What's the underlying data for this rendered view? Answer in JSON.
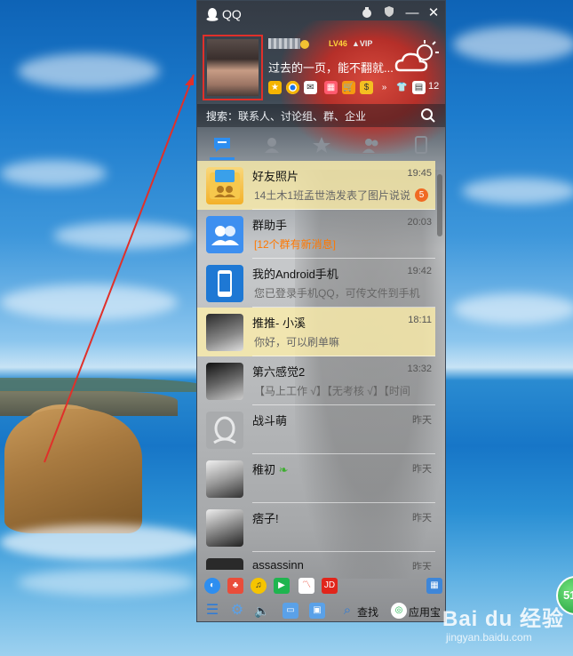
{
  "window": {
    "title": "QQ"
  },
  "profile": {
    "level_badge": "LV46",
    "vip_badge": "VIP",
    "signature": "过去的一页，能不翻就...",
    "app_count": "12"
  },
  "search": {
    "placeholder": "搜索：联系人、讨论组、群、企业"
  },
  "conversations": [
    {
      "title": "好友照片",
      "time": "19:45",
      "message": "14土木1班孟世浩发表了图片说说",
      "unread": "5",
      "highlight": true,
      "icon": "photo-folder-icon"
    },
    {
      "title": "群助手",
      "time": "20:03",
      "message": "[12个群有新消息]",
      "unread": "",
      "highlight": false,
      "icon": "group-helper-icon"
    },
    {
      "title": "我的Android手机",
      "time": "19:42",
      "message": "您已登录手机QQ，可传文件到手机",
      "unread": "",
      "highlight": false,
      "icon": "phone-icon"
    },
    {
      "title": "推推- 小溪",
      "time": "18:11",
      "message": "你好，可以刷单嘛",
      "unread": "",
      "highlight": true,
      "icon": "user-avatar"
    },
    {
      "title": "第六感觉2",
      "time": "13:32",
      "message": "【马上工作 √】【无考核 √】【时间",
      "unread": "",
      "highlight": false,
      "icon": "user-avatar"
    },
    {
      "title": "战斗萌",
      "time": "昨天",
      "message": "",
      "unread": "",
      "highlight": false,
      "icon": "default-avatar"
    },
    {
      "title": "稚初",
      "time": "昨天",
      "message": "",
      "unread": "",
      "highlight": false,
      "icon": "user-avatar"
    },
    {
      "title": "痞子!",
      "time": "昨天",
      "message": "",
      "unread": "",
      "highlight": false,
      "icon": "user-avatar"
    },
    {
      "title": "assassinn",
      "time": "昨天",
      "message": "",
      "unread": "",
      "highlight": false,
      "icon": "penguin-avatar"
    }
  ],
  "bottom_bar": {
    "jd_label": "JD",
    "find_label": "查找",
    "appstore_label": "应用宝"
  },
  "watermark": {
    "brand": "Bai du 经验",
    "url": "jingyan.baidu.com",
    "badge": "51"
  },
  "colors": {
    "accent": "#2d8ef0",
    "highlight_row": "#fff0aa",
    "unread_badge": "#f06a23",
    "annotation_red": "#e0302a"
  }
}
